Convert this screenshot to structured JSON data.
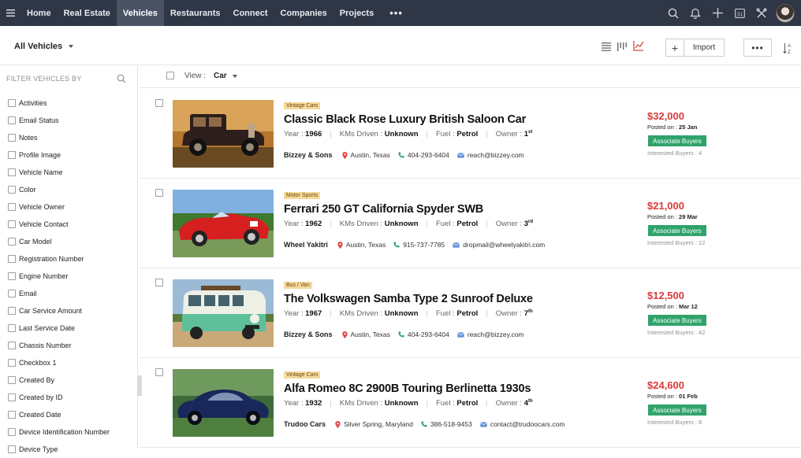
{
  "nav": {
    "items": [
      "Home",
      "Real Estate",
      "Vehicles",
      "Restaurants",
      "Connect",
      "Companies",
      "Projects"
    ],
    "active": "Vehicles",
    "more": "•••",
    "icons": [
      "search-icon",
      "bell-icon",
      "plus-icon",
      "calendar-icon",
      "tools-icon",
      "avatar"
    ]
  },
  "subheader": {
    "view_selector": "All Vehicles",
    "import_label": "Import",
    "more_label": "•••"
  },
  "sidebar": {
    "title": "FILTER VEHICLES BY",
    "filters": [
      "Activities",
      "Email Status",
      "Notes",
      "Profile Image",
      "Vehicle Name",
      "Color",
      "Vehicle Owner",
      "Vehicle Contact",
      "Car Model",
      "Registration Number",
      "Engine Number",
      "Email",
      "Car Service Amount",
      "Last Service Date",
      "Chassis Number",
      "Checkbox 1",
      "Created By",
      "Created by ID",
      "Created Date",
      "Device Identification Number",
      "Device Type"
    ]
  },
  "viewbar": {
    "view_label": "View :",
    "view_value": "Car"
  },
  "labels": {
    "year": "Year :",
    "kms": "KMs Driven :",
    "fuel": "Fuel :",
    "owner": "Owner :",
    "posted_on": "Posted on :",
    "associate": "Associate Buyers",
    "interested": "Interested Buyers :"
  },
  "vehicles": [
    {
      "tag": "Vintage Cars",
      "title": "Classic Black Rose Luxury British Saloon Car",
      "year": "1966",
      "kms": "Unknown",
      "fuel": "Petrol",
      "owner": "1",
      "owner_suffix": "st",
      "dealer": "Bizzey & Sons",
      "location": "Austin, Texas",
      "phone": "404-293-6404",
      "email": "reach@bizzey.com",
      "price": "$32,000",
      "posted": "25 Jan",
      "interested": "4",
      "image": "vintage-black-car"
    },
    {
      "tag": "Motor Sports",
      "title": "Ferrari 250 GT California Spyder SWB",
      "year": "1962",
      "kms": "Unknown",
      "fuel": "Petrol",
      "owner": "3",
      "owner_suffix": "rd",
      "dealer": "Wheel Yakitri",
      "location": "Austin, Texas",
      "phone": "915-737-7785",
      "email": "dropmail@wheelyakitri.com",
      "price": "$21,000",
      "posted": "29 Mar",
      "interested": "12",
      "image": "red-spyder-car"
    },
    {
      "tag": "Bus / Van",
      "title": "The Volkswagen Samba Type 2 Sunroof Deluxe",
      "year": "1967",
      "kms": "Unknown",
      "fuel": "Petrol",
      "owner": "7",
      "owner_suffix": "th",
      "dealer": "Bizzey & Sons",
      "location": "Austin, Texas",
      "phone": "404-293-6404",
      "email": "reach@bizzey.com",
      "price": "$12,500",
      "posted": "Mar 12",
      "interested": "42",
      "image": "green-vw-van"
    },
    {
      "tag": "Vintage Cars",
      "title": "Alfa Romeo 8C 2900B Touring Berlinetta 1930s",
      "year": "1932",
      "kms": "Unknown",
      "fuel": "Petrol",
      "owner": "4",
      "owner_suffix": "th",
      "dealer": "Trudoo Cars",
      "location": "Silver Spring, Maryland",
      "phone": "386-518-9453",
      "email": "contact@trudoocars.com",
      "price": "$24,600",
      "posted": "01 Feb",
      "interested": "8",
      "image": "blue-alfa-car"
    }
  ]
}
